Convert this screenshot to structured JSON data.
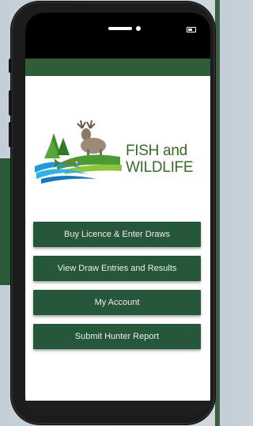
{
  "logo": {
    "line1": "FISH and",
    "line2": "WILDLIFE"
  },
  "menu": {
    "items": [
      {
        "label": "Buy Licence & Enter Draws"
      },
      {
        "label": "View Draw Entries and Results"
      },
      {
        "label": "My Account"
      },
      {
        "label": "Submit Hunter Report"
      }
    ]
  },
  "colors": {
    "brand_green": "#27573a",
    "header_green": "#2f5d3a",
    "logo_text_green": "#3a6b2a"
  }
}
